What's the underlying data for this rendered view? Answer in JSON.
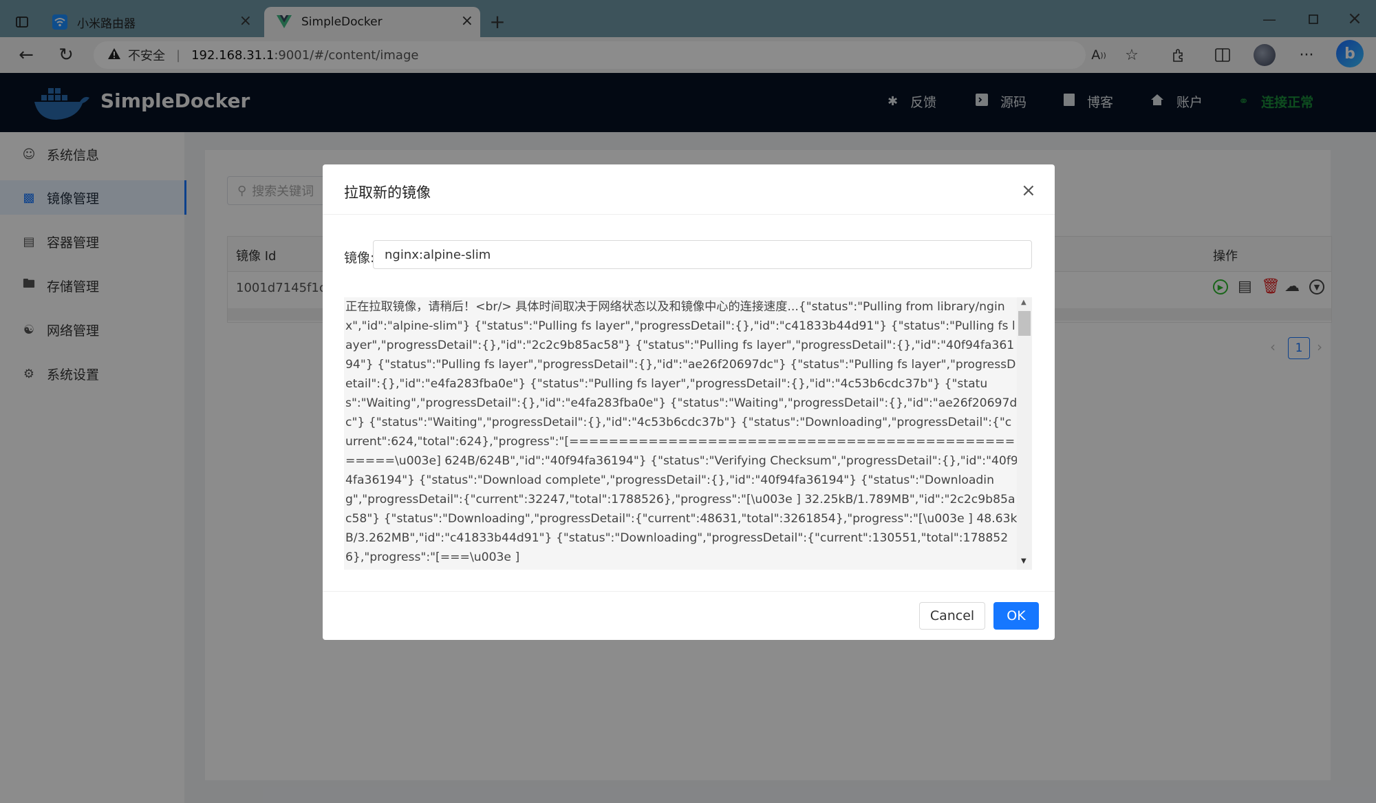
{
  "browser": {
    "tabs": [
      {
        "label": "小米路由器"
      },
      {
        "label": "SimpleDocker"
      }
    ],
    "security_label": "不安全",
    "url_host": "192.168.31.1",
    "url_rest": ":9001/#/content/image"
  },
  "header": {
    "brand": "SimpleDocker",
    "nav": [
      {
        "label": "反馈",
        "icon": "bug-icon"
      },
      {
        "label": "源码",
        "icon": "code-icon"
      },
      {
        "label": "博客",
        "icon": "bookmark-icon"
      },
      {
        "label": "账户",
        "icon": "home-icon"
      }
    ],
    "status": "连接正常",
    "status_color": "#1a8c3a"
  },
  "sidebar": {
    "items": [
      {
        "label": "系统信息",
        "icon": "user-icon"
      },
      {
        "label": "镜像管理",
        "icon": "monitor-icon",
        "active": true
      },
      {
        "label": "容器管理",
        "icon": "document-icon"
      },
      {
        "label": "存储管理",
        "icon": "folder-icon"
      },
      {
        "label": "网络管理",
        "icon": "network-icon"
      },
      {
        "label": "系统设置",
        "icon": "gear-icon"
      }
    ]
  },
  "page": {
    "search_placeholder": "搜索关键词",
    "table": {
      "col_id": "镜像 Id",
      "col_ops": "操作",
      "rows": [
        {
          "id": "1001d7145f1c"
        }
      ]
    },
    "pagination": {
      "current": "1"
    }
  },
  "modal": {
    "title": "拉取新的镜像",
    "image_label": "镜像:",
    "image_value": "nginx:alpine-slim",
    "log": "正在拉取镜像，请稍后！<br/> 具体时间取决于网络状态以及和镜像中心的连接速度...{\"status\":\"Pulling from library/nginx\",\"id\":\"alpine-slim\"} {\"status\":\"Pulling fs layer\",\"progressDetail\":{},\"id\":\"c41833b44d91\"} {\"status\":\"Pulling fs layer\",\"progressDetail\":{},\"id\":\"2c2c9b85ac58\"} {\"status\":\"Pulling fs layer\",\"progressDetail\":{},\"id\":\"40f94fa36194\"} {\"status\":\"Pulling fs layer\",\"progressDetail\":{},\"id\":\"ae26f20697dc\"} {\"status\":\"Pulling fs layer\",\"progressDetail\":{},\"id\":\"e4fa283fba0e\"} {\"status\":\"Pulling fs layer\",\"progressDetail\":{},\"id\":\"4c53b6cdc37b\"} {\"status\":\"Waiting\",\"progressDetail\":{},\"id\":\"e4fa283fba0e\"} {\"status\":\"Waiting\",\"progressDetail\":{},\"id\":\"ae26f20697dc\"} {\"status\":\"Waiting\",\"progressDetail\":{},\"id\":\"4c53b6cdc37b\"} {\"status\":\"Downloading\",\"progressDetail\":{\"current\":624,\"total\":624},\"progress\":\"[==================================================\\u003e] 624B/624B\",\"id\":\"40f94fa36194\"} {\"status\":\"Verifying Checksum\",\"progressDetail\":{},\"id\":\"40f94fa36194\"} {\"status\":\"Download complete\",\"progressDetail\":{},\"id\":\"40f94fa36194\"} {\"status\":\"Downloading\",\"progressDetail\":{\"current\":32247,\"total\":1788526},\"progress\":\"[\\u003e ] 32.25kB/1.789MB\",\"id\":\"2c2c9b85ac58\"} {\"status\":\"Downloading\",\"progressDetail\":{\"current\":48631,\"total\":3261854},\"progress\":\"[\\u003e ] 48.63kB/3.262MB\",\"id\":\"c41833b44d91\"} {\"status\":\"Downloading\",\"progressDetail\":{\"current\":130551,\"total\":1788526},\"progress\":\"[===\\u003e ]",
    "cancel_label": "Cancel",
    "ok_label": "OK"
  },
  "colors": {
    "primary": "#1677ff",
    "header_bg": "#061224",
    "run_green": "#2eb82e",
    "delete_red": "#e02020"
  }
}
